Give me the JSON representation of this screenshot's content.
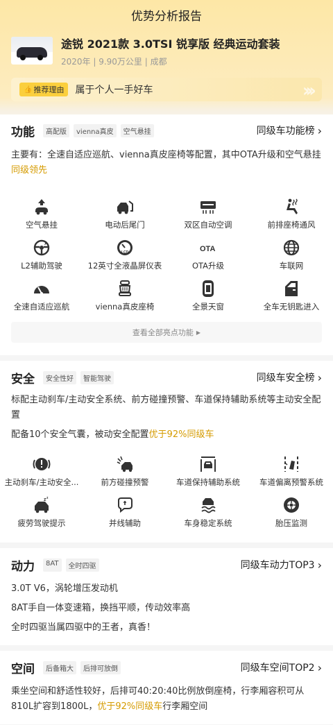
{
  "page_title": "优势分析报告",
  "car": {
    "title": "途锐 2021款 3.0TSI 锐享版 经典运动套装",
    "meta": "2020年 | 9.90万公里 | 成都"
  },
  "reason": {
    "badge": "推荐理由",
    "text": "属于个人一手好车"
  },
  "function": {
    "title": "功能",
    "tags": [
      "高配版",
      "vienna真皮",
      "空气悬挂"
    ],
    "rank_link": "同级车功能榜",
    "desc_prefix": "主要有：全速自适应巡航、vienna真皮座椅等配置，其中OTA升级和空气悬挂",
    "desc_highlight": "同级领先",
    "features": [
      {
        "label": "空气悬挂",
        "icon": "air-suspension-icon"
      },
      {
        "label": "电动后尾门",
        "icon": "power-tailgate-icon"
      },
      {
        "label": "双区自动空调",
        "icon": "dual-zone-ac-icon"
      },
      {
        "label": "前排座椅通风",
        "icon": "seat-ventilation-icon"
      },
      {
        "label": "L2辅助驾驶",
        "icon": "l2-assist-icon"
      },
      {
        "label": "12英寸全液晶屏仪表",
        "icon": "lcd-dashboard-icon"
      },
      {
        "label": "OTA升级",
        "icon": "ota-icon"
      },
      {
        "label": "车联网",
        "icon": "connected-car-icon"
      },
      {
        "label": "全速自适应巡航",
        "icon": "adaptive-cruise-icon"
      },
      {
        "label": "vienna真皮座椅",
        "icon": "leather-seat-icon"
      },
      {
        "label": "全景天窗",
        "icon": "panoramic-sunroof-icon"
      },
      {
        "label": "全车无钥匙进入",
        "icon": "keyless-entry-icon"
      }
    ],
    "more": "查看全部亮点功能"
  },
  "safety": {
    "title": "安全",
    "tags": [
      "安全性好",
      "智能驾驶"
    ],
    "rank_link": "同级车安全榜",
    "desc1": "标配主动刹车/主动安全系统、前方碰撞预警、车道保持辅助系统等主动安全配置",
    "desc2_prefix": "配备10个安全气囊，被动安全配置",
    "desc2_highlight": "优于92%同级车",
    "features": [
      {
        "label": "主动刹车/主动安全...",
        "icon": "active-brake-icon"
      },
      {
        "label": "前方碰撞预警",
        "icon": "collision-warning-icon"
      },
      {
        "label": "车道保持辅助系统",
        "icon": "lane-keep-icon"
      },
      {
        "label": "车道偏离预警系统",
        "icon": "lane-departure-icon"
      },
      {
        "label": "疲劳驾驶提示",
        "icon": "fatigue-alert-icon"
      },
      {
        "label": "并线辅助",
        "icon": "blind-spot-icon"
      },
      {
        "label": "车身稳定系统",
        "icon": "stability-control-icon"
      },
      {
        "label": "胎压监测",
        "icon": "tire-pressure-icon"
      }
    ]
  },
  "power": {
    "title": "动力",
    "tags": [
      "8AT",
      "全时四驱"
    ],
    "rank_link": "同级车动力TOP3",
    "lines": [
      "3.0T V6，涡轮增压发动机",
      "8AT手自一体变速箱，换挡平顺，传动效率高",
      "全时四驱当属四驱中的王者，真香！"
    ]
  },
  "space": {
    "title": "空间",
    "tags": [
      "后备箱大",
      "后排可放倒"
    ],
    "rank_link": "同级车空间TOP2",
    "desc_prefix": "乘坐空间和舒适性较好，后排可40:20:40比例放倒座椅，行李厢容积可从810L扩容到1800L，",
    "desc_highlight": "优于92%同级车",
    "desc_suffix": "行李厢空间"
  },
  "colors": {
    "accent": "#fbcf3d",
    "highlight": "#d59b00"
  }
}
